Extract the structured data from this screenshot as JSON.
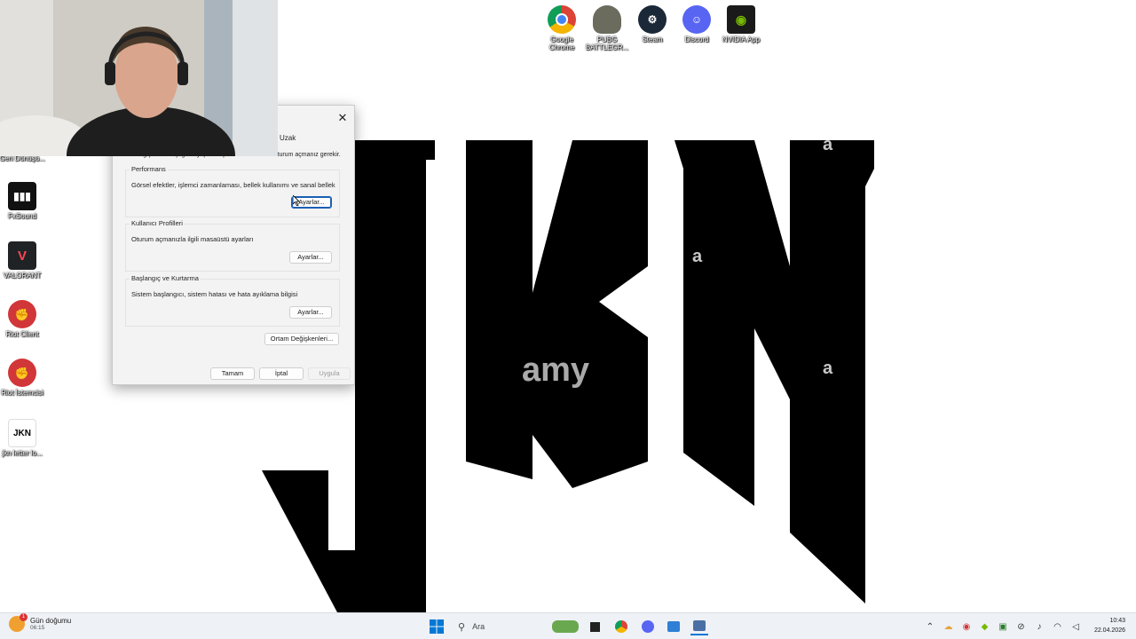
{
  "desktop_icons_top": [
    {
      "name": "google-chrome",
      "label": "Google Chrome"
    },
    {
      "name": "pubg",
      "label": "PUBG BATTLEGR..."
    },
    {
      "name": "steam",
      "label": "Steam"
    },
    {
      "name": "discord",
      "label": "Discord"
    },
    {
      "name": "nvidia-app",
      "label": "NVIDIA App"
    }
  ],
  "desktop_icons_left": [
    {
      "name": "geri-donusum",
      "label": "Geri Dönüşü..."
    },
    {
      "name": "fxsound",
      "label": "FxSound"
    },
    {
      "name": "valorant",
      "label": "VALORANT"
    },
    {
      "name": "riot-client",
      "label": "Riot Client"
    },
    {
      "name": "riot-istemcisi",
      "label": "Riot İstemcisi"
    },
    {
      "name": "jkn-letter",
      "label": "jkn letter lo..."
    }
  ],
  "wallpaper": {
    "watermarks": [
      "a",
      "a",
      "a",
      "amy"
    ]
  },
  "dialog": {
    "tab_fragment": "Uzak",
    "top_note": "Bu değişikliklerin çoğunu yapmak için Yönetici olarak oturum açmanız gerekir.",
    "groups": [
      {
        "title": "Performans",
        "desc": "Görsel efektler, işlemci zamanlaması, bellek kullanımı ve sanal bellek",
        "button": "Ayarlar..."
      },
      {
        "title": "Kullanıcı Profilleri",
        "desc": "Oturum açmanızla ilgili masaüstü ayarları",
        "button": "Ayarlar..."
      },
      {
        "title": "Başlangıç ve Kurtarma",
        "desc": "Sistem başlangıcı, sistem hatası ve hata ayıklama bilgisi",
        "button": "Ayarlar..."
      }
    ],
    "env_button": "Ortam Değişkenleri...",
    "ok": "Tamam",
    "cancel": "İptal",
    "apply": "Uygula"
  },
  "taskbar": {
    "weather_title": "Gün doğumu",
    "weather_time": "06:15",
    "weather_badge": "1",
    "search_placeholder": "Ara",
    "time": "10:43",
    "date": "22.04.2026"
  },
  "colors": {
    "accent": "#1a5fb4",
    "taskbar_bg": "#eef1f6",
    "dialog_bg": "#f3f3f3"
  }
}
